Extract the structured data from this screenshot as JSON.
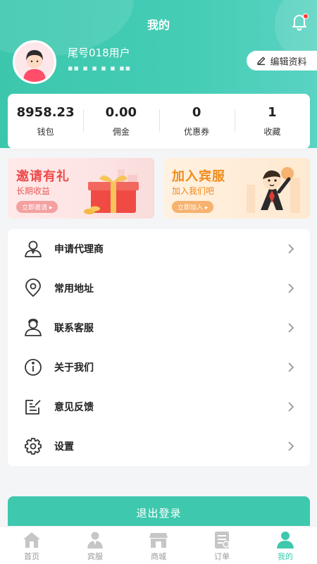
{
  "header": {
    "title": "我的",
    "username": "尾号018用户",
    "phone_masked": "▪▪ ▪ ▪ ▪ ▪ ▪▪",
    "edit_label": "编辑资料",
    "accent": "#3ec8ae"
  },
  "stats": [
    {
      "value": "8958.23",
      "label": "钱包"
    },
    {
      "value": "0.00",
      "label": "佣金"
    },
    {
      "value": "0",
      "label": "优惠券"
    },
    {
      "value": "1",
      "label": "收藏"
    }
  ],
  "banners": {
    "invite": {
      "title": "邀请有礼",
      "subtitle": "长期收益",
      "button": "立即邀请 ▸"
    },
    "join": {
      "title": "加入宾服",
      "subtitle": "加入我们吧",
      "button": "立即加入 ▸"
    }
  },
  "menu": [
    {
      "label": "申请代理商",
      "icon": "person-icon"
    },
    {
      "label": "常用地址",
      "icon": "location-pin-icon"
    },
    {
      "label": "联系客服",
      "icon": "customer-service-icon"
    },
    {
      "label": "关于我们",
      "icon": "info-icon"
    },
    {
      "label": "意见反馈",
      "icon": "feedback-icon"
    },
    {
      "label": "设置",
      "icon": "gear-icon"
    }
  ],
  "logout_label": "退出登录",
  "tabs": [
    {
      "label": "首页",
      "icon": "home-icon",
      "active": false
    },
    {
      "label": "宾服",
      "icon": "service-person-icon",
      "active": false
    },
    {
      "label": "商城",
      "icon": "store-icon",
      "active": false
    },
    {
      "label": "订单",
      "icon": "order-icon",
      "active": false
    },
    {
      "label": "我的",
      "icon": "profile-icon",
      "active": true
    }
  ]
}
